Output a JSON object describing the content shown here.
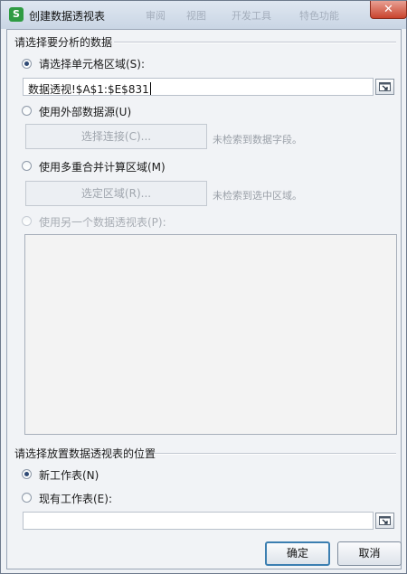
{
  "window": {
    "title": "创建数据透视表",
    "app_icon": "S",
    "close_glyph": "✕",
    "background_ribbon_texts": [
      "审阅",
      "视图",
      "开发工具",
      "特色功能"
    ]
  },
  "source_section": {
    "title": "请选择要分析的数据",
    "range_option": {
      "label": "请选择单元格区域(S):",
      "value": "数据透视!$A$1:$E$831",
      "selected": true
    },
    "external_option": {
      "label": "使用外部数据源(U)",
      "selected": false,
      "button_label": "选择连接(C)...",
      "hint": "未检索到数据字段。"
    },
    "multi_range_option": {
      "label": "使用多重合并计算区域(M)",
      "selected": false,
      "button_label": "选定区域(R)...",
      "hint": "未检索到选中区域。"
    },
    "other_pivot_option": {
      "label": "使用另一个数据透视表(P):",
      "selected": false,
      "enabled": false
    }
  },
  "placement_section": {
    "title": "请选择放置数据透视表的位置",
    "new_sheet_option": {
      "label": "新工作表(N)",
      "selected": true
    },
    "existing_sheet_option": {
      "label": "现有工作表(E):",
      "selected": false,
      "value": ""
    }
  },
  "buttons": {
    "ok_label": "确定",
    "cancel_label": "取消"
  },
  "icons": {
    "app": "wps-spreadsheet-icon",
    "close": "close-icon",
    "range_picker": "range-picker-icon"
  }
}
